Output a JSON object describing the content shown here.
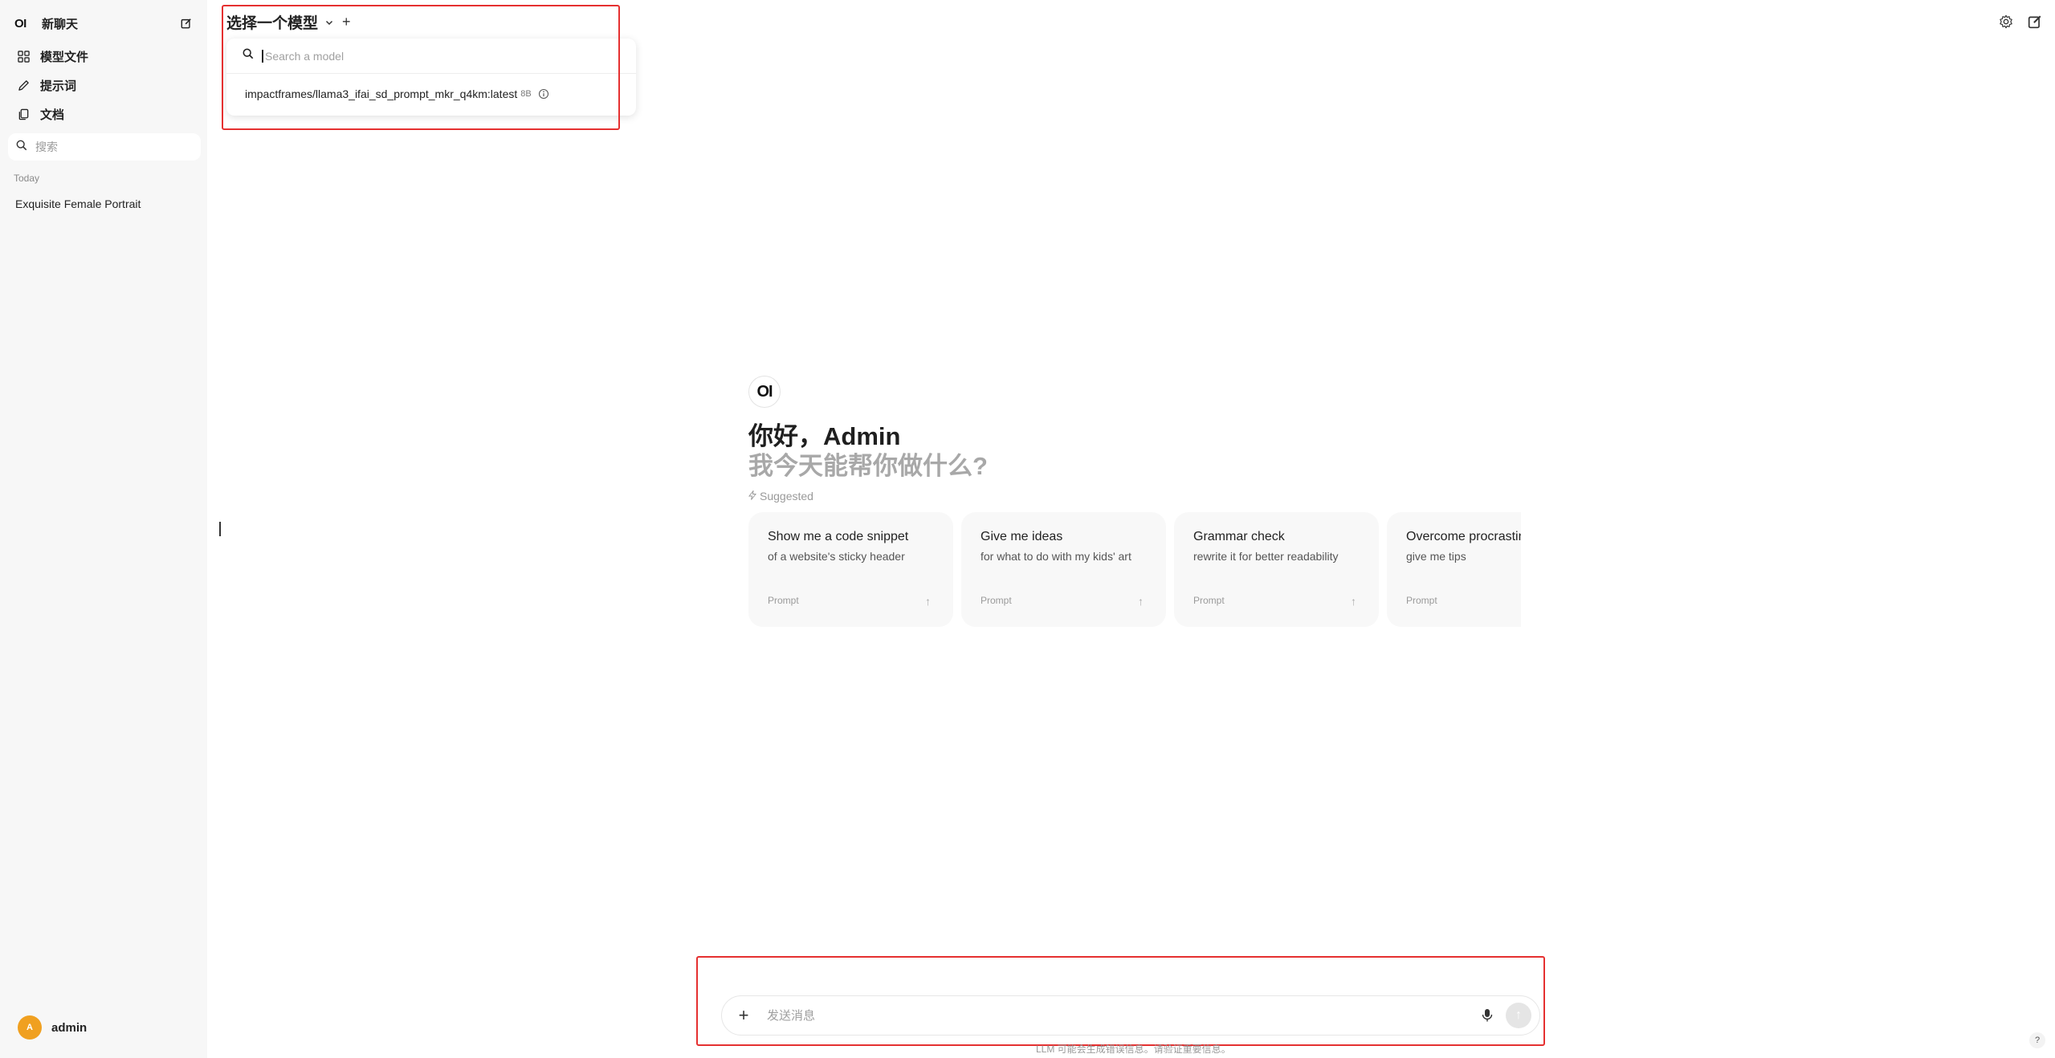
{
  "sidebar": {
    "logo": "OI",
    "new_chat_label": "新聊天",
    "nav": [
      {
        "label": "模型文件",
        "icon": "grid-icon"
      },
      {
        "label": "提示词",
        "icon": "pencil-icon"
      },
      {
        "label": "文档",
        "icon": "documents-icon"
      }
    ],
    "search_placeholder": "搜索",
    "section_label": "Today",
    "chats": [
      "Exquisite Female Portrait"
    ],
    "user": {
      "initial": "A",
      "name": "admin",
      "avatar_color": "#f0a020"
    }
  },
  "header": {
    "model_select_label": "选择一个模型",
    "add_label": "+"
  },
  "model_dropdown": {
    "search_placeholder": "Search a model",
    "items": [
      {
        "name": "impactframes/llama3_ifai_sd_prompt_mkr_q4km:latest",
        "size": "8B"
      }
    ]
  },
  "welcome": {
    "logo": "OI",
    "greeting": "你好，Admin",
    "subtitle": "我今天能帮你做什么?",
    "suggested_label": "Suggested",
    "cards": [
      {
        "title": "Show me a code snippet",
        "subtitle": "of a website's sticky header",
        "tag": "Prompt"
      },
      {
        "title": "Give me ideas",
        "subtitle": "for what to do with my kids' art",
        "tag": "Prompt"
      },
      {
        "title": "Grammar check",
        "subtitle": "rewrite it for better readability",
        "tag": "Prompt"
      },
      {
        "title": "Overcome procrastination",
        "subtitle": "give me tips",
        "tag": "Prompt"
      }
    ]
  },
  "chat_input": {
    "placeholder": "发送消息",
    "disclaimer": "LLM 可能会生成错误信息。请验证重要信息。"
  },
  "help_label": "?",
  "colors": {
    "highlight": "#e53030",
    "accent": "#f0a020"
  }
}
